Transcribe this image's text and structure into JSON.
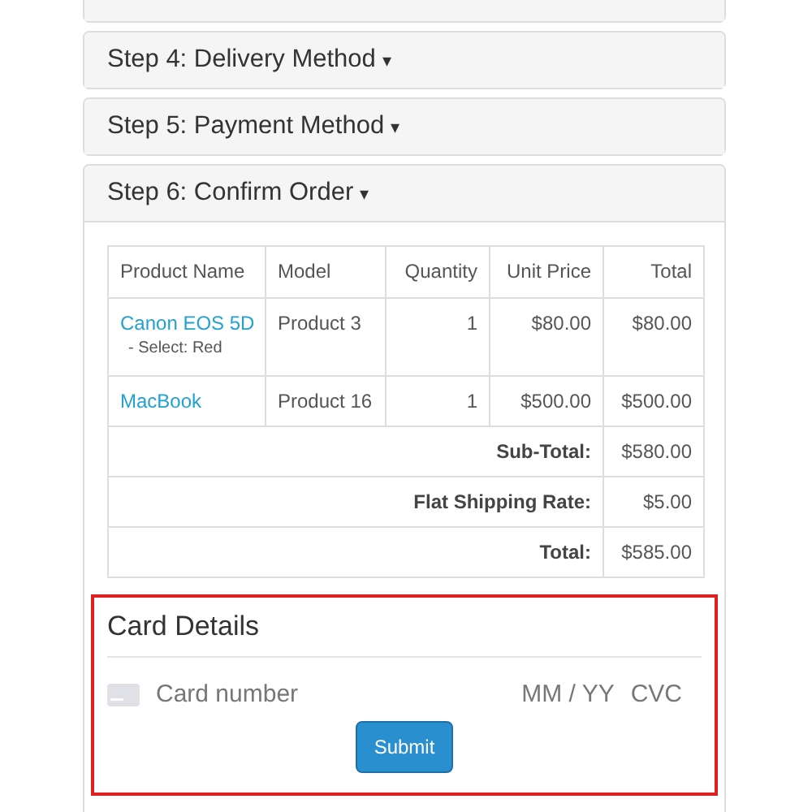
{
  "panels": [
    {
      "title": "Step 4: Delivery Method",
      "caret": "▾",
      "expanded": false
    },
    {
      "title": "Step 5: Payment Method",
      "caret": "▾",
      "expanded": false
    },
    {
      "title": "Step 6: Confirm Order",
      "caret": "▾",
      "expanded": true
    }
  ],
  "order_table": {
    "columns": [
      "Product Name",
      "Model",
      "Quantity",
      "Unit Price",
      "Total"
    ],
    "rows": [
      {
        "product": "Canon EOS 5D",
        "option": "- Select: Red",
        "model": "Product 3",
        "quantity": "1",
        "unit_price": "$80.00",
        "total": "$80.00"
      },
      {
        "product": "MacBook",
        "model": "Product 16",
        "quantity": "1",
        "unit_price": "$500.00",
        "total": "$500.00"
      }
    ],
    "totals": [
      {
        "label": "Sub-Total:",
        "value": "$580.00"
      },
      {
        "label": "Flat Shipping Rate:",
        "value": "$5.00"
      },
      {
        "label": "Total:",
        "value": "$585.00"
      }
    ]
  },
  "card_details": {
    "title": "Card Details",
    "card_number_placeholder": "Card number",
    "expiry_placeholder": "MM / YY",
    "cvc_placeholder": "CVC",
    "submit": "Submit"
  }
}
